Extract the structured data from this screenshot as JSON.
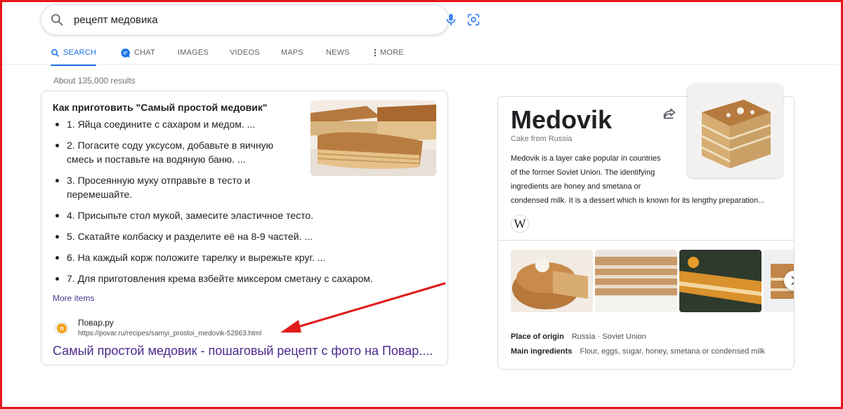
{
  "search": {
    "query": "рецепт медовика"
  },
  "tabs": [
    {
      "label": "SEARCH"
    },
    {
      "label": "CHAT"
    },
    {
      "label": "IMAGES"
    },
    {
      "label": "VIDEOS"
    },
    {
      "label": "MAPS"
    },
    {
      "label": "NEWS"
    },
    {
      "label": "MORE"
    }
  ],
  "result_stats": "About 135,000 results",
  "snippet": {
    "title": "Как приготовить \"Самый простой медовик\"",
    "steps": [
      "1. Яйца соедините с сахаром и медом. ...",
      "2. Погасите соду уксусом, добавьте в яичную смесь и поставьте на водяную баню. ...",
      "3. Просеянную муку отправьте в тесто и перемешайте.",
      "4. Присыпьте стол мукой, замесите эластичное тесто.",
      "5. Скатайте колбаску и разделите её на 8-9 частей. ...",
      "6. На каждый корж положите тарелку и вырежьте круг. ...",
      "7. Для приготовления крема взбейте миксером сметану с сахаром."
    ],
    "more_items": "More items",
    "source_name": "Повар.ру",
    "source_url": "https://povar.ru/recipes/samyi_prostoi_medovik-52863.html",
    "link_text": "Самый простой медовик - пошаговый рецепт с фото на Повар...."
  },
  "knowledge_panel": {
    "title": "Medovik",
    "subtitle": "Cake from Russia",
    "description_lines": [
      "Medovik is a layer cake popular in countries",
      "of the former Soviet Union. The identifying",
      "ingredients are honey and smetana or",
      "condensed milk. It is a dessert which is known for its lengthy preparation..."
    ],
    "wiki_glyph": "W",
    "facts": [
      {
        "label": "Place of origin",
        "value": "Russia · Soviet Union"
      },
      {
        "label": "Main ingredients",
        "value": "Flour, eggs, sugar, honey, smetana or condensed milk"
      }
    ]
  },
  "colors": {
    "accent": "#1a73e8",
    "visited_link": "#4b2a8e",
    "arrow": "#e01b1b",
    "frame": "#e8141c"
  }
}
